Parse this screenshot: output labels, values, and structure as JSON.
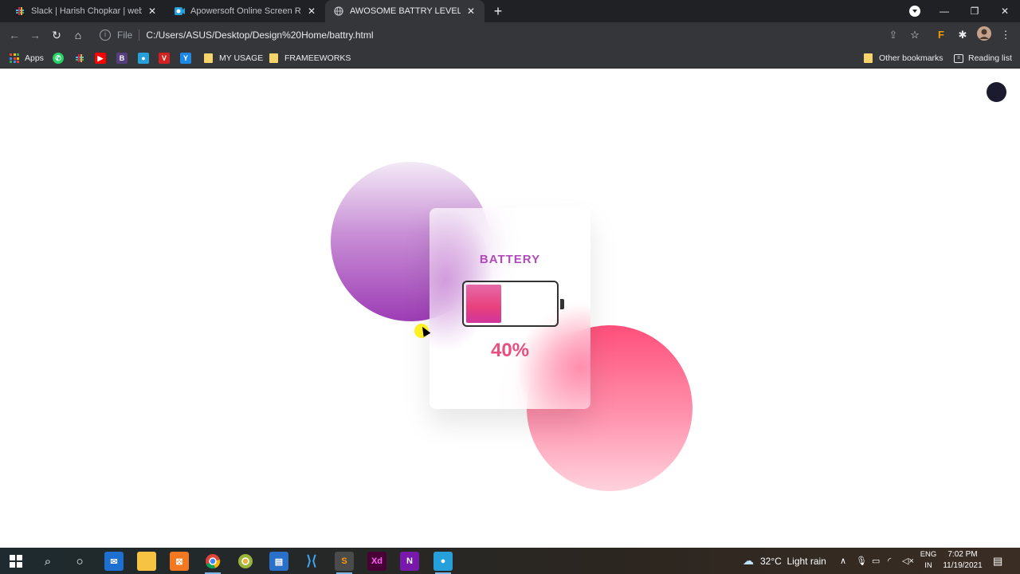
{
  "tabs": [
    {
      "title": "Slack | Harish Chopkar | webguru",
      "icon": "slack-icon"
    },
    {
      "title": "Apowersoft Online Screen Recorder",
      "icon": "apowersoft-icon"
    },
    {
      "title": "AWOSOME BATTRY LEVEL",
      "icon": "globe-icon"
    }
  ],
  "address_bar": {
    "scheme_label": "File",
    "url": "C:/Users/ASUS/Desktop/Design%20Home/battry.html"
  },
  "bookmarks": {
    "apps_label": "Apps",
    "items": [
      "MY USAGE",
      "FRAMEEWORKS"
    ],
    "other_label": "Other bookmarks",
    "reading_list_label": "Reading list"
  },
  "widget": {
    "title": "BATTERY",
    "level_percent": 40,
    "percent_label": "40%",
    "colors": {
      "title": "#b04bb8",
      "percent": "#e8507f",
      "fill_start": "#e56aa8",
      "fill_end": "#e8407b",
      "purple_circle": "#9d3db5",
      "pink_circle": "#ff4f7a"
    }
  },
  "taskbar": {
    "weather": "32°C  Light rain",
    "lang_top": "ENG",
    "lang_bottom": "IN",
    "time": "7:02 PM",
    "date": "11/19/2021"
  }
}
